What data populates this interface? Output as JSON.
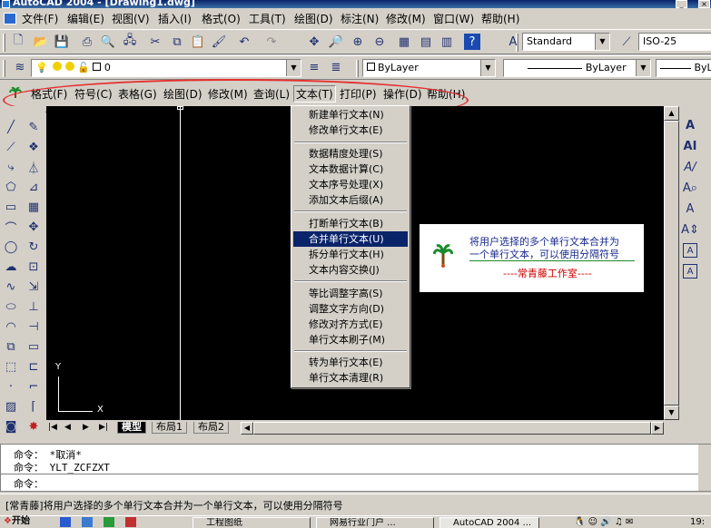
{
  "window": {
    "title": "AutoCAD 2004 - [Drawing1.dwg]",
    "controls": {
      "minimize": "_",
      "close": "×"
    }
  },
  "menubar": {
    "items": [
      "文件(F)",
      "编辑(E)",
      "视图(V)",
      "插入(I)",
      "格式(O)",
      "工具(T)",
      "绘图(D)",
      "标注(N)",
      "修改(M)",
      "窗口(W)",
      "帮助(H)"
    ]
  },
  "toolbar2": {
    "text_style": "Standard",
    "dim_style": "ISO-25"
  },
  "layers": {
    "current_layer": "0",
    "color": "ByLayer",
    "linetype": "ByLayer",
    "lineweight": "ByL"
  },
  "custom_menu": {
    "items": [
      "格式(F)",
      "符号(C)",
      "表格(G)",
      "绘图(D)",
      "修改(M)",
      "查询(L)",
      "文本(T)",
      "打印(P)",
      "操作(D)",
      "帮助(H)"
    ],
    "active": "文本(T)"
  },
  "text_menu": {
    "groups": [
      [
        "新建单行文本(N)",
        "修改单行文本(E)"
      ],
      [
        "数据精度处理(S)",
        "文本数据计算(C)",
        "文本序号处理(X)",
        "添加文本后缀(A)"
      ],
      [
        "打断单行文本(B)",
        "合并单行文本(U)",
        "拆分单行文本(H)",
        "文本内容交换(J)"
      ],
      [
        "等比调整字高(S)",
        "调整文字方向(D)",
        "修改对齐方式(E)",
        "单行文本刷子(M)"
      ],
      [
        "转为单行文本(E)",
        "单行文本清理(R)"
      ]
    ],
    "highlighted": "合并单行文本(U)"
  },
  "tooltip": {
    "line1": "将用户选择的多个单行文本合并为",
    "line2": "一个单行文本，可以使用分隔符号",
    "author": "----常青藤工作室----"
  },
  "ucs": {
    "x": "X",
    "y": "Y"
  },
  "layout_tabs": [
    "模型",
    "布局1",
    "布局2"
  ],
  "command": {
    "lines": [
      "命令：   *取消*",
      "命令：   YLT_ZCFZXT",
      "命令："
    ]
  },
  "status": {
    "text": "[常青藤]将用户选择的多个单行文本合并为一个单行文本，可以使用分隔符号"
  },
  "taskbar": {
    "start": "开始",
    "tasks": [
      "工程图纸",
      "网易行业门户 ...",
      "AutoCAD 2004 ..."
    ],
    "clock": "19:"
  },
  "colors": {
    "title_bar": "#0a246a",
    "highlight": "#0a246a",
    "tooltip_text": "#1a2a8c",
    "tooltip_author": "#cc0000",
    "annotation_oval": "#e53030"
  }
}
